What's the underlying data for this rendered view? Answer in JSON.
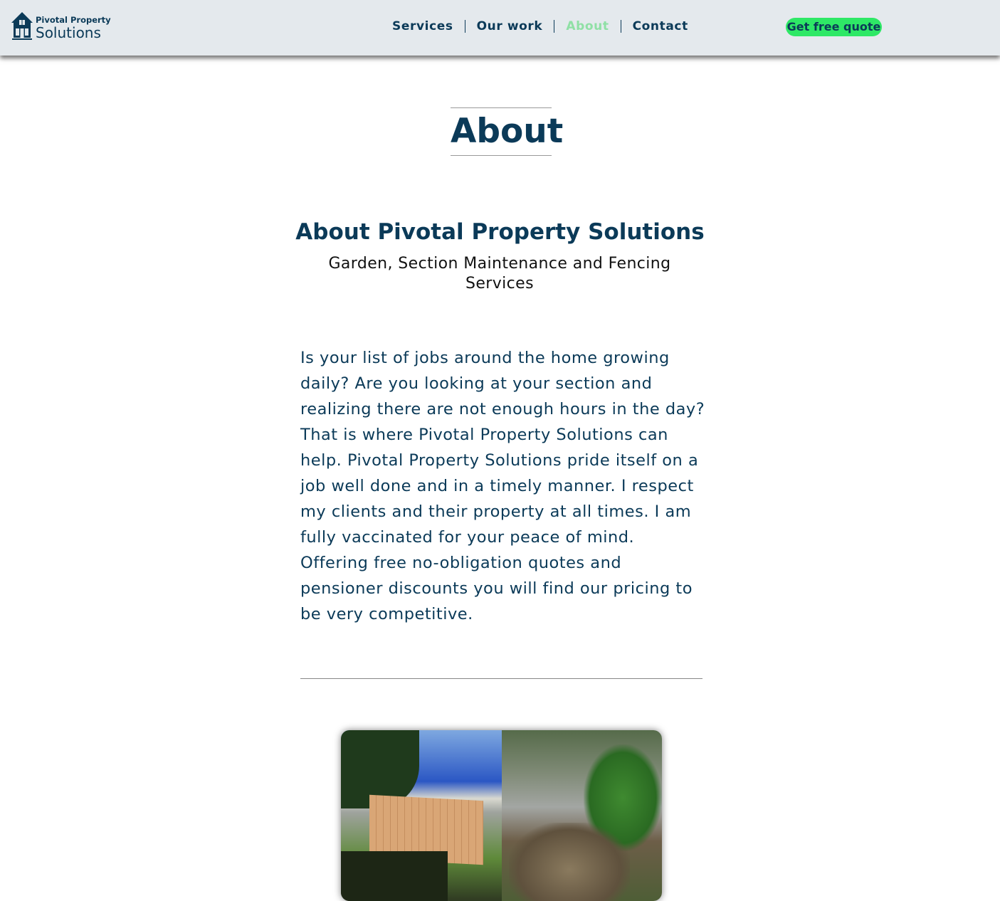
{
  "header": {
    "logo": {
      "line1": "Pivotal Property",
      "line2": "Solutions",
      "icon": "house-icon"
    },
    "nav": [
      {
        "label": "Services",
        "active": false
      },
      {
        "label": "Our work",
        "active": false
      },
      {
        "label": "About",
        "active": true
      },
      {
        "label": "Contact",
        "active": false
      }
    ],
    "cta_label": "Get free quote"
  },
  "colors": {
    "brand": "#0b3a58",
    "accent": "#2ee866",
    "active_nav": "#8fe0a5",
    "header_bg": "#e4e9ed"
  },
  "main": {
    "page_title": "About",
    "heading": "About Pivotal Property Solutions",
    "subheading": "Garden, Section Maintenance and Fencing Services",
    "paragraph": "Is your list of jobs around the home growing daily? Are you looking at your section and realizing there are not enough hours in the day? That is where Pivotal Property Solutions can help. Pivotal Property Solutions pride itself on a job well done and in a timely manner. I respect my clients and their property at all times. I am fully vaccinated for your peace of mind. Offering free no-obligation quotes and pensioner discounts you will find our pricing to be very competitive."
  }
}
